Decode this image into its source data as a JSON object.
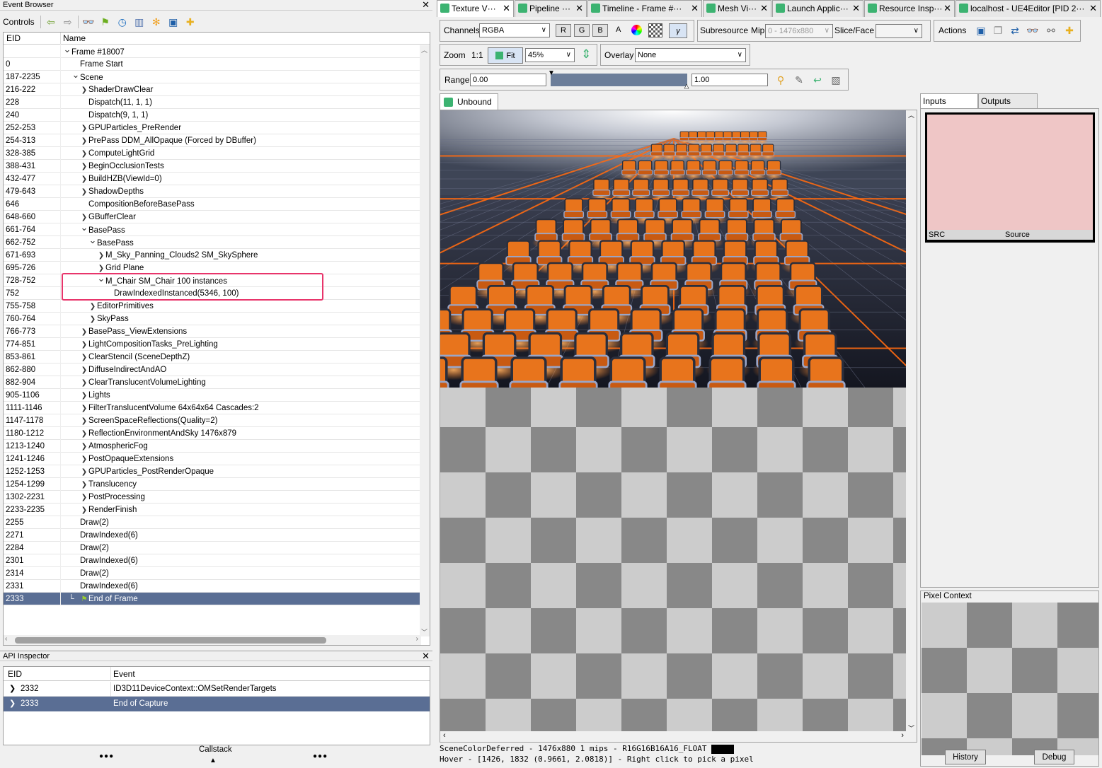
{
  "event_browser": {
    "title": "Event Browser",
    "controls_label": "Controls",
    "col_eid": "EID",
    "col_name": "Name",
    "rows": [
      {
        "eid": "",
        "name": "Frame #18007",
        "depth": 0,
        "exp": "open"
      },
      {
        "eid": "0",
        "name": "Frame Start",
        "depth": 1,
        "exp": "none"
      },
      {
        "eid": "187-2235",
        "name": "Scene",
        "depth": 1,
        "exp": "open"
      },
      {
        "eid": "216-222",
        "name": "ShaderDrawClear",
        "depth": 2,
        "exp": "closed"
      },
      {
        "eid": "228",
        "name": "Dispatch(11, 1, 1)",
        "depth": 2,
        "exp": "none"
      },
      {
        "eid": "240",
        "name": "Dispatch(9, 1, 1)",
        "depth": 2,
        "exp": "none"
      },
      {
        "eid": "252-253",
        "name": "GPUParticles_PreRender",
        "depth": 2,
        "exp": "closed"
      },
      {
        "eid": "254-313",
        "name": "PrePass DDM_AllOpaque (Forced by DBuffer)",
        "depth": 2,
        "exp": "closed"
      },
      {
        "eid": "328-385",
        "name": "ComputeLightGrid",
        "depth": 2,
        "exp": "closed"
      },
      {
        "eid": "388-431",
        "name": "BeginOcclusionTests",
        "depth": 2,
        "exp": "closed"
      },
      {
        "eid": "432-477",
        "name": "BuildHZB(ViewId=0)",
        "depth": 2,
        "exp": "closed"
      },
      {
        "eid": "479-643",
        "name": "ShadowDepths",
        "depth": 2,
        "exp": "closed"
      },
      {
        "eid": "646",
        "name": "CompositionBeforeBasePass",
        "depth": 2,
        "exp": "none"
      },
      {
        "eid": "648-660",
        "name": "GBufferClear",
        "depth": 2,
        "exp": "closed"
      },
      {
        "eid": "661-764",
        "name": "BasePass",
        "depth": 2,
        "exp": "open"
      },
      {
        "eid": "662-752",
        "name": "BasePass",
        "depth": 3,
        "exp": "open"
      },
      {
        "eid": "671-693",
        "name": "M_Sky_Panning_Clouds2 SM_SkySphere",
        "depth": 4,
        "exp": "closed"
      },
      {
        "eid": "695-726",
        "name": "Grid Plane",
        "depth": 4,
        "exp": "closed"
      },
      {
        "eid": "728-752",
        "name": "M_Chair SM_Chair 100 instances",
        "depth": 4,
        "exp": "open"
      },
      {
        "eid": "752",
        "name": "DrawIndexedInstanced(5346, 100)",
        "depth": 5,
        "exp": "none"
      },
      {
        "eid": "755-758",
        "name": "EditorPrimitives",
        "depth": 3,
        "exp": "closed"
      },
      {
        "eid": "760-764",
        "name": "SkyPass",
        "depth": 3,
        "exp": "closed"
      },
      {
        "eid": "766-773",
        "name": "BasePass_ViewExtensions",
        "depth": 2,
        "exp": "closed"
      },
      {
        "eid": "774-851",
        "name": "LightCompositionTasks_PreLighting",
        "depth": 2,
        "exp": "closed"
      },
      {
        "eid": "853-861",
        "name": "ClearStencil (SceneDepthZ)",
        "depth": 2,
        "exp": "closed"
      },
      {
        "eid": "862-880",
        "name": "DiffuseIndirectAndAO",
        "depth": 2,
        "exp": "closed"
      },
      {
        "eid": "882-904",
        "name": "ClearTranslucentVolumeLighting",
        "depth": 2,
        "exp": "closed"
      },
      {
        "eid": "905-1106",
        "name": "Lights",
        "depth": 2,
        "exp": "closed"
      },
      {
        "eid": "1111-1146",
        "name": "FilterTranslucentVolume 64x64x64 Cascades:2",
        "depth": 2,
        "exp": "closed"
      },
      {
        "eid": "1147-1178",
        "name": "ScreenSpaceReflections(Quality=2)",
        "depth": 2,
        "exp": "closed"
      },
      {
        "eid": "1180-1212",
        "name": "ReflectionEnvironmentAndSky 1476x879",
        "depth": 2,
        "exp": "closed"
      },
      {
        "eid": "1213-1240",
        "name": "AtmosphericFog",
        "depth": 2,
        "exp": "closed"
      },
      {
        "eid": "1241-1246",
        "name": "PostOpaqueExtensions",
        "depth": 2,
        "exp": "closed"
      },
      {
        "eid": "1252-1253",
        "name": "GPUParticles_PostRenderOpaque",
        "depth": 2,
        "exp": "closed"
      },
      {
        "eid": "1254-1299",
        "name": "Translucency",
        "depth": 2,
        "exp": "closed"
      },
      {
        "eid": "1302-2231",
        "name": "PostProcessing",
        "depth": 2,
        "exp": "closed"
      },
      {
        "eid": "2233-2235",
        "name": "RenderFinish",
        "depth": 2,
        "exp": "closed"
      },
      {
        "eid": "2255",
        "name": "Draw(2)",
        "depth": 1,
        "exp": "none"
      },
      {
        "eid": "2271",
        "name": "DrawIndexed(6)",
        "depth": 1,
        "exp": "none"
      },
      {
        "eid": "2284",
        "name": "Draw(2)",
        "depth": 1,
        "exp": "none"
      },
      {
        "eid": "2301",
        "name": "DrawIndexed(6)",
        "depth": 1,
        "exp": "none"
      },
      {
        "eid": "2314",
        "name": "Draw(2)",
        "depth": 1,
        "exp": "none"
      },
      {
        "eid": "2331",
        "name": "DrawIndexed(6)",
        "depth": 1,
        "exp": "none"
      },
      {
        "eid": "2333",
        "name": "End of Frame",
        "depth": 2,
        "exp": "flag",
        "selected": true
      }
    ]
  },
  "api_inspector": {
    "title": "API Inspector",
    "col_eid": "EID",
    "col_event": "Event",
    "rows": [
      {
        "eid": "2332",
        "event": "ID3D11DeviceContext::OMSetRenderTargets"
      },
      {
        "eid": "2333",
        "event": "End of Capture"
      }
    ],
    "callstack_label": "Callstack",
    "dots": "●●●"
  },
  "tabs": [
    {
      "label": "Texture V···"
    },
    {
      "label": "Pipeline ···"
    },
    {
      "label": "Timeline - Frame #···"
    },
    {
      "label": "Mesh Vi···"
    },
    {
      "label": "Launch Applic···"
    },
    {
      "label": "Resource Insp···"
    },
    {
      "label": "localhost - UE4Editor [PID 2···"
    }
  ],
  "texture_viewer": {
    "channels_label": "Channels",
    "channels_value": "RGBA",
    "r": "R",
    "g": "G",
    "b": "B",
    "a": "A",
    "subresource_label": "Subresource",
    "mip_label": "Mip",
    "mip_value": "0 - 1476x880",
    "slice_label": "Slice/Face",
    "actions_label": "Actions",
    "zoom_label": "Zoom",
    "zoom_1to1": "1:1",
    "fit_label": "Fit",
    "zoom_value": "45%",
    "overlay_label": "Overlay",
    "overlay_value": "None",
    "range_label": "Range",
    "range_min": "0.00",
    "range_max": "1.00",
    "unbound_tab": "Unbound",
    "status_line1": "SceneColorDeferred - 1476x880 1 mips - R16G16B16A16_FLOAT",
    "status_line2": "Hover - [1426, 1832 (0.9661, 2.0818)] - Right click to pick a pixel"
  },
  "side_panel": {
    "inputs_tab": "Inputs",
    "outputs_tab": "Outputs",
    "thumb_left": "SRC",
    "thumb_center": "Source",
    "pixel_context_title": "Pixel Context",
    "history_button": "History",
    "debug_button": "Debug"
  },
  "colors": {
    "selection": "#5a6e94",
    "highlight_box": "#e8356b",
    "accent_green": "#3cb371",
    "thumb_pink": "#efc6c6",
    "chair_orange": "#e8741c"
  }
}
